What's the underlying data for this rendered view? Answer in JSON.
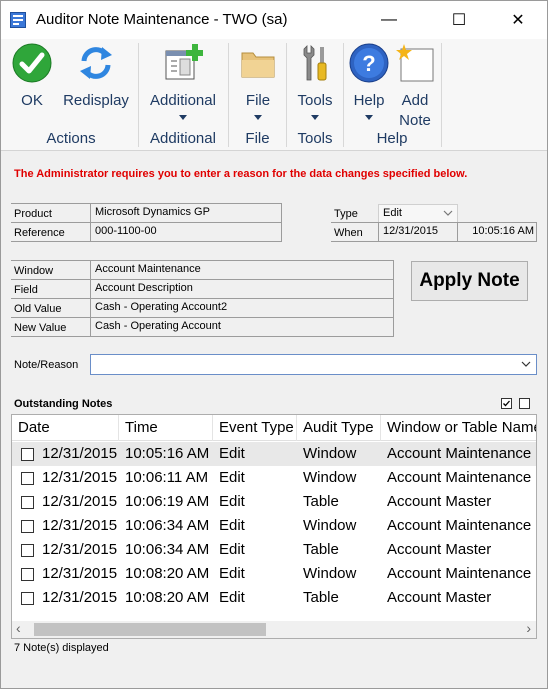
{
  "window": {
    "title": "Auditor Note Maintenance  -  TWO (sa)",
    "minimize_glyph": "—",
    "maximize_glyph": "☐",
    "close_glyph": "✕"
  },
  "ribbon": {
    "ok_label": "OK",
    "redisplay_label": "Redisplay",
    "additional_label": "Additional",
    "file_label": "File",
    "tools_label": "Tools",
    "help_label": "Help",
    "add_note_label_1": "Add",
    "add_note_label_2": "Note",
    "groups": {
      "actions": "Actions",
      "additional": "Additional",
      "file": "File",
      "tools": "Tools",
      "help": "Help"
    }
  },
  "warning": "The Administrator requires you to enter a reason for the data changes specified below.",
  "product": {
    "label": "Product",
    "value": "Microsoft Dynamics GP"
  },
  "reference": {
    "label": "Reference",
    "value": "000-1100-00"
  },
  "type": {
    "label": "Type",
    "value": "Edit"
  },
  "when": {
    "label": "When",
    "date": "12/31/2015",
    "time": "10:05:16 AM"
  },
  "change": {
    "window_label": "Window",
    "window_value": "Account Maintenance",
    "field_label": "Field",
    "field_value": "Account Description",
    "old_label": "Old Value",
    "old_value": "Cash - Operating Account2",
    "new_label": "New Value",
    "new_value": "Cash - Operating Account"
  },
  "apply_note_label": "Apply Note",
  "note_reason": {
    "label": "Note/Reason",
    "value": ""
  },
  "outstanding": {
    "title": "Outstanding Notes",
    "columns": [
      "Date",
      "Time",
      "Event Type",
      "Audit Type",
      "Window or Table Name"
    ],
    "rows": [
      [
        "12/31/2015",
        "10:05:16 AM",
        "Edit",
        "Window",
        "Account Maintenance"
      ],
      [
        "12/31/2015",
        "10:06:11 AM",
        "Edit",
        "Window",
        "Account Maintenance"
      ],
      [
        "12/31/2015",
        "10:06:19 AM",
        "Edit",
        "Table",
        "Account Master"
      ],
      [
        "12/31/2015",
        "10:06:34 AM",
        "Edit",
        "Window",
        "Account Maintenance"
      ],
      [
        "12/31/2015",
        "10:06:34 AM",
        "Edit",
        "Table",
        "Account Master"
      ],
      [
        "12/31/2015",
        "10:08:20 AM",
        "Edit",
        "Window",
        "Account Maintenance"
      ],
      [
        "12/31/2015",
        "10:08:20 AM",
        "Edit",
        "Table",
        "Account Master"
      ]
    ],
    "scroll_left_glyph": "‹",
    "scroll_right_glyph": "›"
  },
  "status": "7 Note(s) displayed"
}
